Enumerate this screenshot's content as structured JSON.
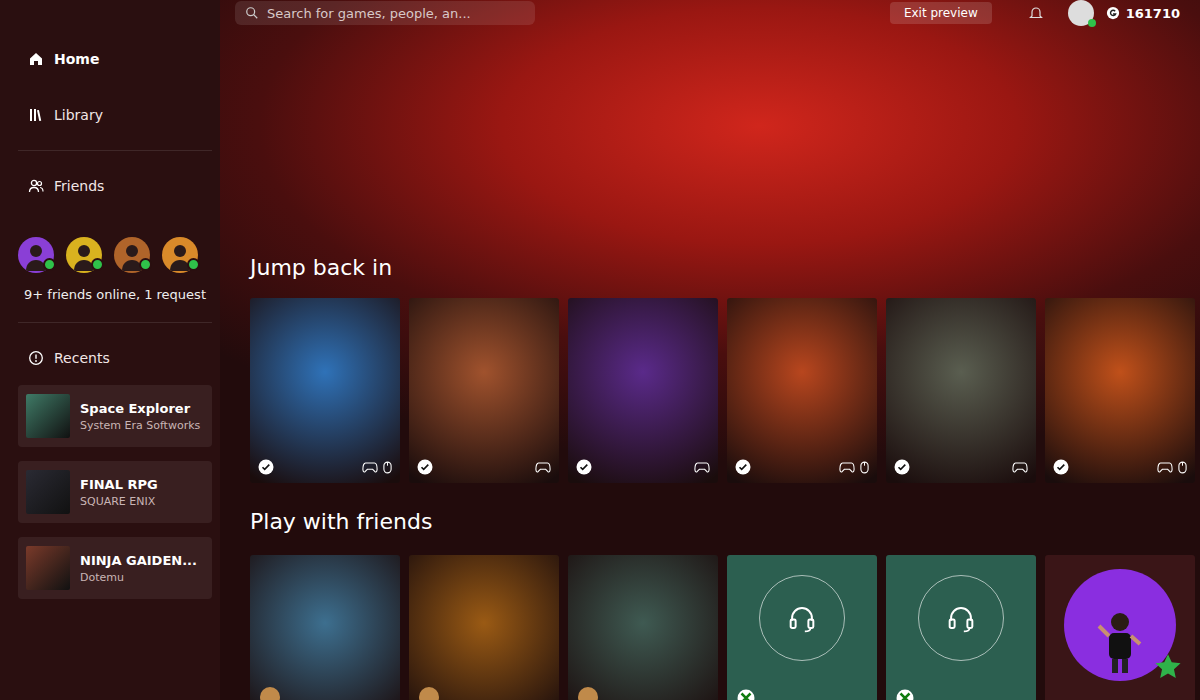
{
  "search": {
    "placeholder": "Search for games, people, an..."
  },
  "header": {
    "exit_preview": "Exit preview",
    "gamerscore": "161710"
  },
  "sidebar": {
    "items": [
      {
        "label": "Home",
        "selected": true
      },
      {
        "label": "Library",
        "selected": false
      }
    ],
    "friends": {
      "label": "Friends",
      "status": "9+ friends online, 1 request",
      "avatars": [
        {
          "color": "#8a3fd6",
          "online": true
        },
        {
          "color": "#d9b21f",
          "online": true
        },
        {
          "color": "#b0642a",
          "online": true
        },
        {
          "color": "#d98a2a",
          "online": true
        }
      ]
    },
    "recents": {
      "label": "Recents",
      "items": [
        {
          "title": "Space Explorer",
          "subtitle": "System Era Softworks",
          "color": "#3f7a66"
        },
        {
          "title": "FINAL RPG",
          "subtitle": "SQUARE ENIX",
          "color": "#2a2a33"
        },
        {
          "title": "NINJA GAIDEN...",
          "subtitle": "Dotemu",
          "color": "#7a3a2a"
        }
      ]
    }
  },
  "jump_back_in": {
    "title": "Jump back in",
    "games": [
      {
        "color": "#2f72b8",
        "installed": true,
        "pc": true
      },
      {
        "color": "#a0522d",
        "installed": true,
        "pc": false
      },
      {
        "color": "#5a2a8a",
        "installed": true,
        "pc": false
      },
      {
        "color": "#b8461e",
        "installed": true,
        "pc": true
      },
      {
        "color": "#5a5e50",
        "installed": true,
        "pc": false
      },
      {
        "color": "#c0501a",
        "installed": true,
        "pc": true
      }
    ]
  },
  "play_with_friends": {
    "title": "Play with friends",
    "tiles": [
      {
        "kind": "game",
        "color": "#3d6f8f"
      },
      {
        "kind": "game",
        "color": "#9a5a14"
      },
      {
        "kind": "game",
        "color": "#3f5a52"
      },
      {
        "kind": "party",
        "color": "#2c5f50"
      },
      {
        "kind": "party",
        "color": "#2c5f50"
      },
      {
        "kind": "avatar",
        "color": "#8a2ee0"
      }
    ]
  }
}
